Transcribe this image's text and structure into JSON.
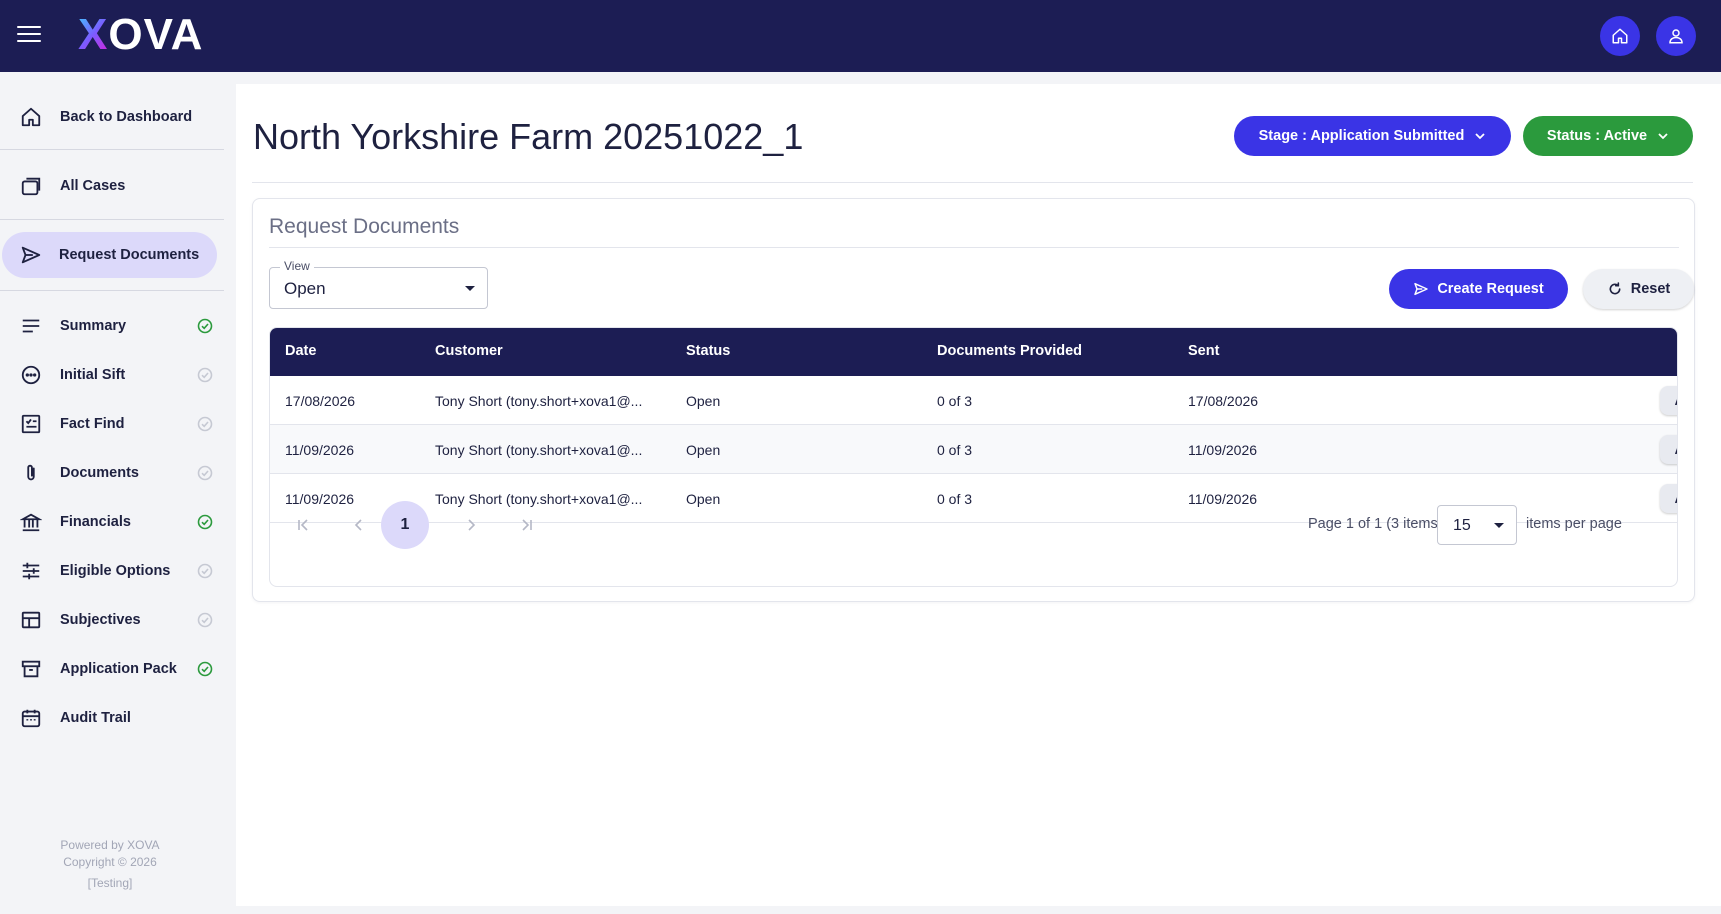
{
  "brand": {
    "logo_text_prefix": "X",
    "logo_text_rest": "OVA",
    "accent": "#3a34e6",
    "header_bg": "#1c1d54",
    "success": "#2b9a3d"
  },
  "sidebar": {
    "back": {
      "label": "Back to Dashboard",
      "icon": "home-icon"
    },
    "all_cases": {
      "label": "All Cases",
      "icon": "folders-icon"
    },
    "request_documents": {
      "label": "Request Documents",
      "icon": "send-icon"
    },
    "items": [
      {
        "label": "Summary",
        "icon": "list-icon",
        "status": "complete"
      },
      {
        "label": "Initial Sift",
        "icon": "dots-circle-icon",
        "status": "pending"
      },
      {
        "label": "Fact Find",
        "icon": "checklist-icon",
        "status": "pending"
      },
      {
        "label": "Documents",
        "icon": "paperclip-icon",
        "status": "pending"
      },
      {
        "label": "Financials",
        "icon": "bank-icon",
        "status": "complete"
      },
      {
        "label": "Eligible Options",
        "icon": "sliders-icon",
        "status": "pending"
      },
      {
        "label": "Subjectives",
        "icon": "table-icon",
        "status": "pending"
      },
      {
        "label": "Application Pack",
        "icon": "archive-icon",
        "status": "complete"
      },
      {
        "label": "Audit Trail",
        "icon": "calendar-icon",
        "status": "none"
      }
    ],
    "footer": {
      "powered": "Powered by XOVA",
      "copyright": "Copyright © 2026",
      "env": "[Testing]"
    }
  },
  "page": {
    "title": "North Yorkshire Farm 20251022_1",
    "stage_label": "Stage : Application Submitted",
    "status_label": "Status : Active"
  },
  "card": {
    "title": "Request Documents",
    "view": {
      "legend": "View",
      "value": "Open"
    },
    "create_label": "Create Request",
    "reset_label": "Reset"
  },
  "table": {
    "headers": [
      "Date",
      "Customer",
      "Status",
      "Documents Provided",
      "Sent"
    ],
    "rows": [
      {
        "date": "17/08/2026",
        "customer": "Tony Short (tony.short+xova1@...",
        "status": "Open",
        "docs": "0 of 3",
        "sent": "17/08/2026",
        "actions": "Actions"
      },
      {
        "date": "11/09/2026",
        "customer": "Tony Short (tony.short+xova1@...",
        "status": "Open",
        "docs": "0 of 3",
        "sent": "11/09/2026",
        "actions": "Actions"
      },
      {
        "date": "11/09/2026",
        "customer": "Tony Short (tony.short+xova1@...",
        "status": "Open",
        "docs": "0 of 3",
        "sent": "11/09/2026",
        "actions": "Actions"
      }
    ]
  },
  "pager": {
    "current_page": "1",
    "info": "Page 1 of 1 (3 items)",
    "page_size": "15",
    "per_page_label": "items per page"
  }
}
